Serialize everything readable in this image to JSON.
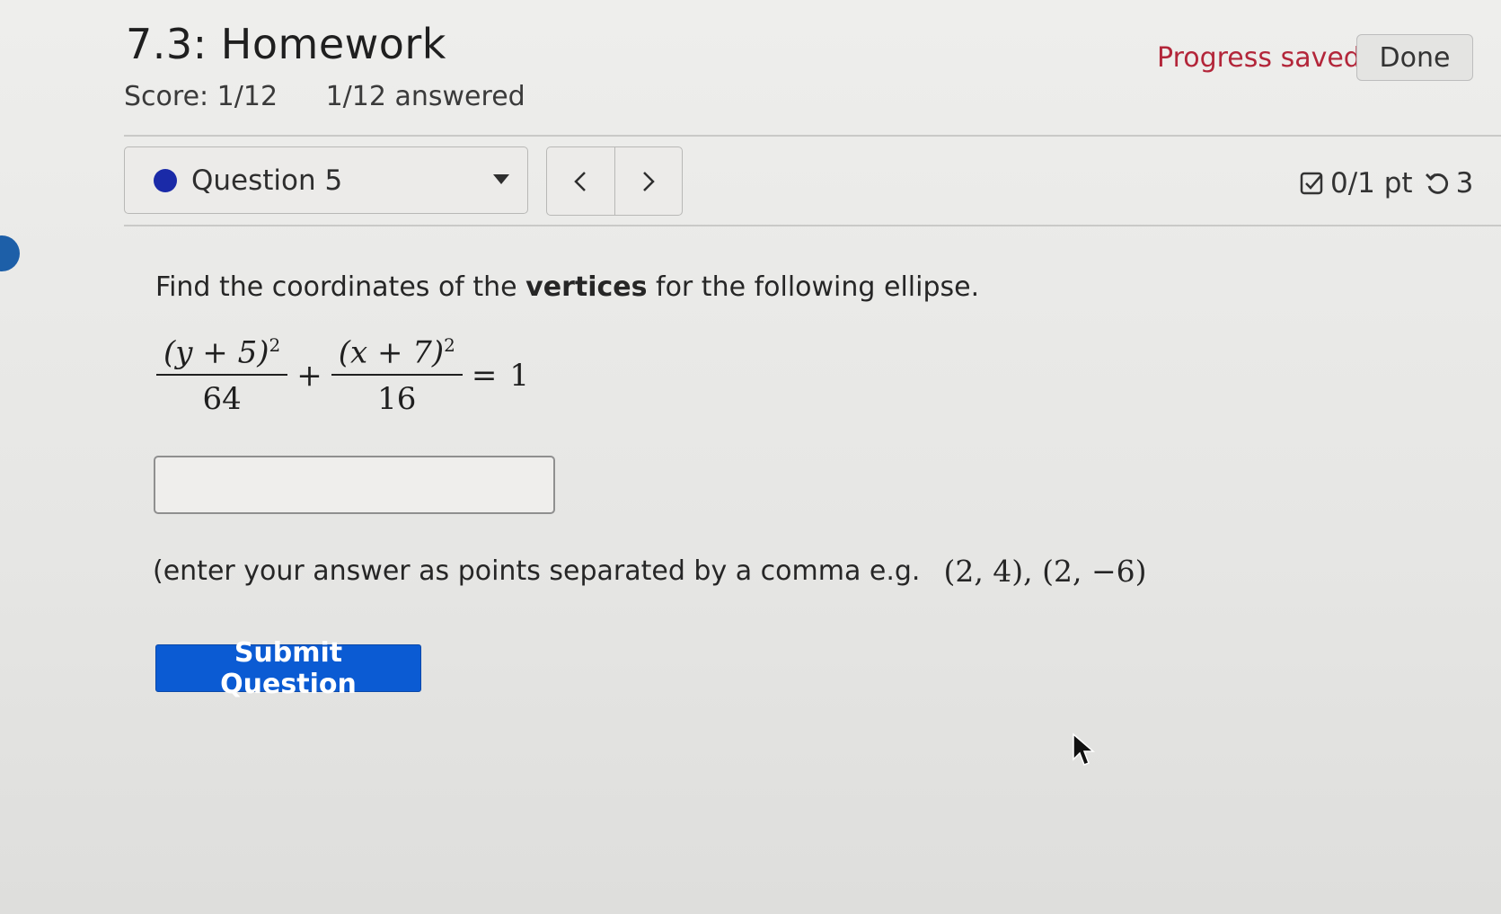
{
  "header": {
    "title": "7.3: Homework",
    "score": "Score: 1/12",
    "answered": "1/12 answered",
    "progress_status": "Progress saved",
    "done_label": "Done"
  },
  "question_nav": {
    "selected_question": "Question 5",
    "prev_label": "<",
    "next_label": ">",
    "points": "0/1 pt",
    "retries": "3"
  },
  "question": {
    "prompt_before": "Find the coordinates of the ",
    "prompt_bold": "vertices",
    "prompt_after": " for the following ellipse.",
    "formula": {
      "term1_num": "(y + 5)",
      "term1_exp": "2",
      "term1_den": "64",
      "plus": "+",
      "term2_num": "(x + 7)",
      "term2_exp": "2",
      "term2_den": "16",
      "equals": "=",
      "rhs": "1"
    },
    "answer_value": "",
    "hint_text": "(enter your answer as points separated by a comma e.g.",
    "hint_example": "(2, 4), (2, −6)"
  },
  "actions": {
    "submit_label": "Submit Question"
  },
  "colors": {
    "progress_red": "#b3263a",
    "submit_blue": "#0b5bd3",
    "question_dot": "#1a2aa8"
  },
  "icons": {
    "checkbox": "checkbox-edit-icon",
    "retry": "retry-icon",
    "caret": "caret-down-icon"
  }
}
